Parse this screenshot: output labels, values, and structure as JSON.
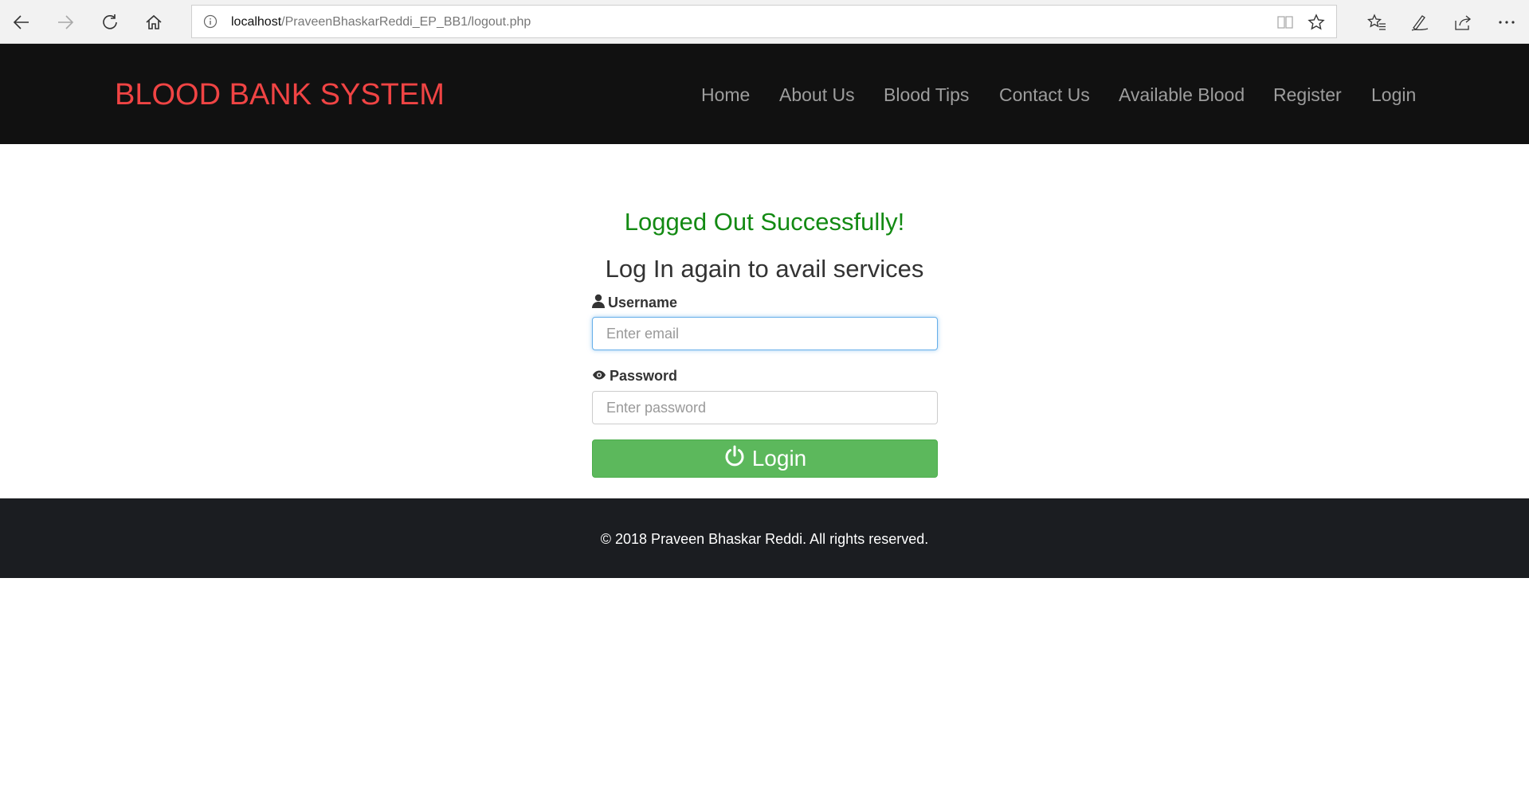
{
  "browser": {
    "url_host": "localhost",
    "url_path": "/PraveenBhaskarReddi_EP_BB1/logout.php",
    "icons": [
      "back-icon",
      "forward-icon",
      "refresh-icon",
      "home-icon",
      "info-icon",
      "reading-view-icon",
      "favorite-star-icon",
      "favorites-list-icon",
      "pen-icon",
      "share-icon",
      "more-icon"
    ]
  },
  "navbar": {
    "brand": "BLOOD BANK SYSTEM",
    "links": [
      "Home",
      "About Us",
      "Blood Tips",
      "Contact Us",
      "Available Blood",
      "Register",
      "Login"
    ]
  },
  "main": {
    "success_message": "Logged Out Successfully!",
    "subheading": "Log In again to avail services",
    "username_label": "Username",
    "username_placeholder": "Enter email",
    "password_label": "Password",
    "password_placeholder": "Enter password",
    "login_button": "Login"
  },
  "footer": {
    "text": "© 2018 Praveen Bhaskar Reddi. All rights reserved."
  },
  "colors": {
    "brand": "#f04444",
    "success": "#138a13",
    "navbar_bg": "#111111",
    "footer_bg": "#1b1d21",
    "button_green": "#5cb85c"
  }
}
